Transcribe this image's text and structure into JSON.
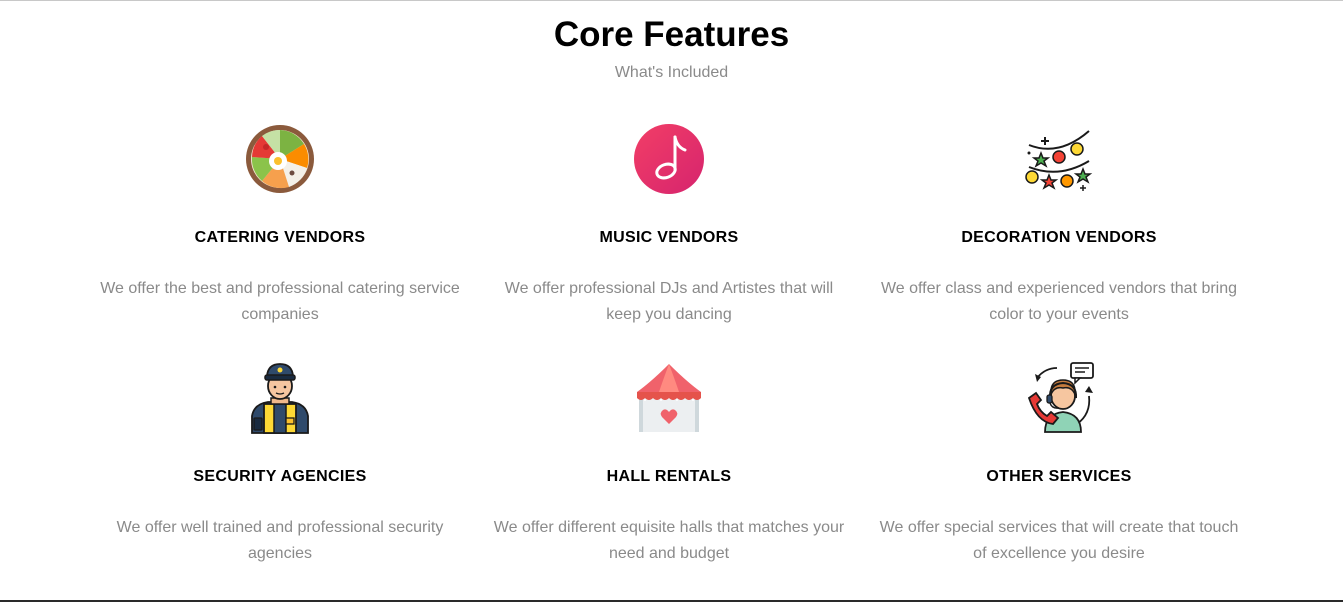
{
  "section": {
    "title": "Core Features",
    "subtitle": "What's Included"
  },
  "features": [
    {
      "icon": "food-bowl-icon",
      "title": "CATERING VENDORS",
      "description": "We offer the best and professional catering service companies"
    },
    {
      "icon": "music-note-icon",
      "title": "MUSIC VENDORS",
      "description": "We offer professional DJs and Artistes that will keep you dancing"
    },
    {
      "icon": "party-lights-icon",
      "title": "DECORATION VENDORS",
      "description": "We offer class and experienced vendors that bring color to your events"
    },
    {
      "icon": "security-guard-icon",
      "title": "SECURITY AGENCIES",
      "description": "We offer well trained and professional security agencies"
    },
    {
      "icon": "hall-tent-icon",
      "title": "HALL RENTALS",
      "description": "We offer different equisite halls that matches your need and budget"
    },
    {
      "icon": "customer-support-icon",
      "title": "OTHER SERVICES",
      "description": "We offer special services that will create that touch of excellence you desire"
    }
  ],
  "colors": {
    "title": "#000000",
    "muted_text": "#8a8a8a",
    "music_icon_pink": "#f23e66",
    "music_icon_magenta": "#d6246e",
    "tent_red": "#f0626b"
  }
}
